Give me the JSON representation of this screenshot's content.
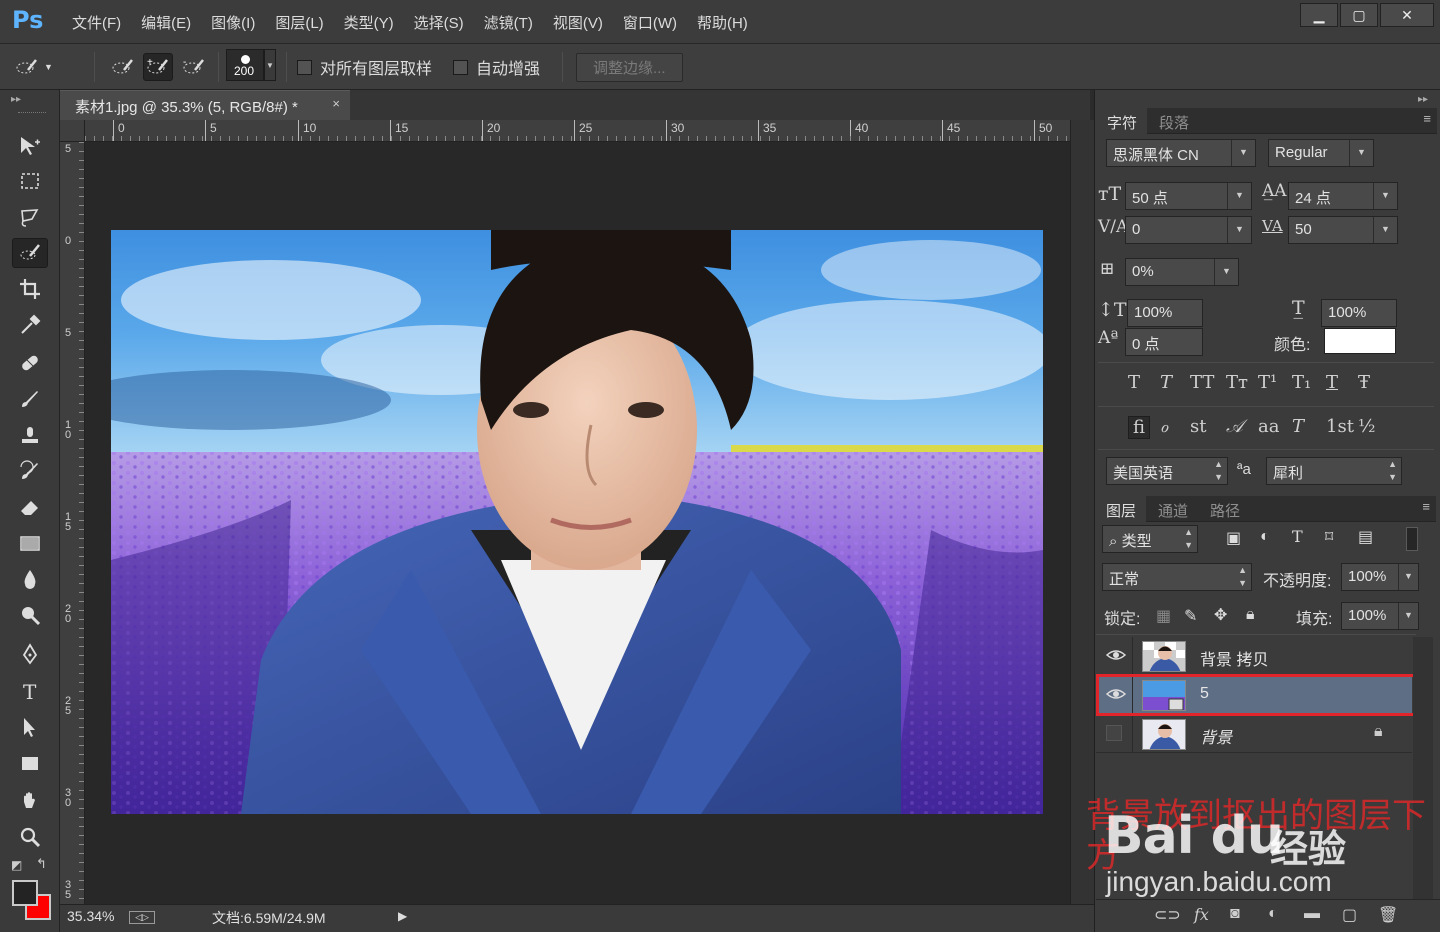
{
  "app": {
    "logo": "Ps"
  },
  "menu": [
    "文件(F)",
    "编辑(E)",
    "图像(I)",
    "图层(L)",
    "类型(Y)",
    "选择(S)",
    "滤镜(T)",
    "视图(V)",
    "窗口(W)",
    "帮助(H)"
  ],
  "window_controls": {
    "minimize": "▁",
    "maximize": "▢",
    "close": "✕"
  },
  "options_bar": {
    "brush_size": "200",
    "sample_all_layers": "对所有图层取样",
    "auto_enhance": "自动增强",
    "refine_edge": "调整边缘..."
  },
  "document": {
    "tab_title": "素材1.jpg @ 35.3% (5, RGB/8#) *",
    "tab_close": "×",
    "ruler_h": [
      "0",
      "5",
      "10",
      "15",
      "20",
      "25",
      "30",
      "35",
      "40",
      "45",
      "50"
    ],
    "ruler_v": [
      "5",
      "0",
      "5",
      "1\n0",
      "1\n5",
      "2\n0",
      "2\n5",
      "3\n0",
      "3\n5"
    ]
  },
  "status": {
    "zoom": "35.34%",
    "doc_info": "文档:6.59M/24.9M",
    "play": "▶"
  },
  "character_panel": {
    "tabs": [
      "字符",
      "段落"
    ],
    "font_family": "思源黑体 CN",
    "font_style": "Regular",
    "font_size": "50 点",
    "leading": "24 点",
    "kerning": "0",
    "tracking": "50",
    "tsume": "0%",
    "vertical_scale": "100%",
    "horizontal_scale": "100%",
    "baseline_shift": "0 点",
    "color_label": "颜色:",
    "text_color": "#ffffff",
    "style_buttons": [
      "T",
      "T",
      "TT",
      "Tт",
      "T¹",
      "T₁",
      "T",
      "Ŧ"
    ],
    "opentype_buttons": [
      "ﬁ",
      "ℴ",
      "st",
      "𝒜",
      "aa",
      "T",
      "1st",
      "½"
    ],
    "language": "美国英语",
    "aa_icon": "ªa",
    "antialias": "犀利"
  },
  "layers_panel": {
    "tabs": [
      "图层",
      "通道",
      "路径"
    ],
    "filter_kind": "类型",
    "blend_mode": "正常",
    "opacity_label": "不透明度:",
    "opacity": "100%",
    "lock_label": "锁定:",
    "fill_label": "填充:",
    "fill": "100%",
    "layers": [
      {
        "name": "背景 拷贝",
        "visible": true,
        "selected": false,
        "locked": false
      },
      {
        "name": "5",
        "visible": true,
        "selected": true,
        "locked": false
      },
      {
        "name": "背景",
        "visible": false,
        "selected": false,
        "locked": true
      }
    ]
  },
  "annotation": {
    "text": "背景放到抠出的图层下方",
    "watermark_logo": "Bai du",
    "watermark_jy": "经验",
    "watermark_url": "jingyan.baidu.com"
  }
}
